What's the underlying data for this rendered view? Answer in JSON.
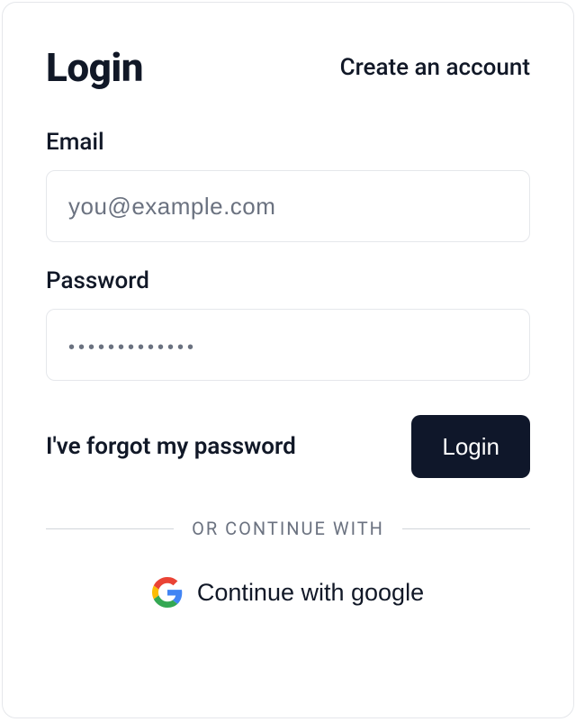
{
  "header": {
    "title": "Login",
    "create_account": "Create an account"
  },
  "form": {
    "email_label": "Email",
    "email_placeholder": "you@example.com",
    "password_label": "Password",
    "password_placeholder": "•••••••••••••",
    "forgot": "I've forgot my password",
    "submit": "Login"
  },
  "divider": {
    "text": "OR CONTINUE WITH"
  },
  "oauth": {
    "google_label": "Continue with google"
  }
}
